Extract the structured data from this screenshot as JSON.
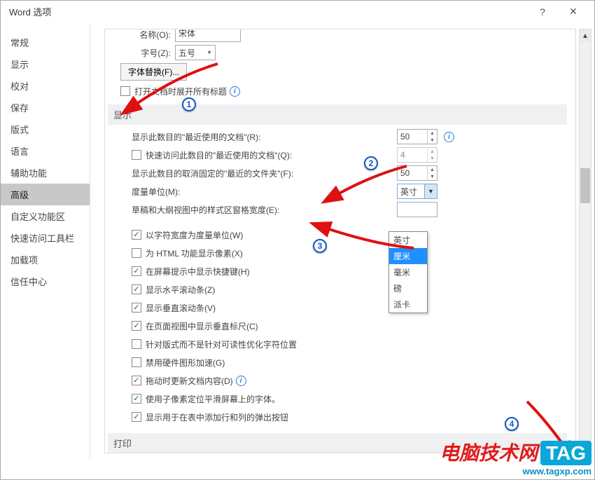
{
  "window": {
    "title": "Word 选项",
    "help": "?",
    "close": "✕"
  },
  "sidebar": {
    "items": [
      {
        "label": "常规"
      },
      {
        "label": "显示"
      },
      {
        "label": "校对"
      },
      {
        "label": "保存"
      },
      {
        "label": "版式"
      },
      {
        "label": "语言"
      },
      {
        "label": "辅助功能"
      },
      {
        "label": "高级"
      },
      {
        "label": "自定义功能区"
      },
      {
        "label": "快速访问工具栏"
      },
      {
        "label": "加载项"
      },
      {
        "label": "信任中心"
      }
    ],
    "selected_index": 7
  },
  "top": {
    "name_label": "名称(O):",
    "name_value": "宋体",
    "size_label": "字号(Z):",
    "size_value": "五号",
    "font_sub_button": "字体替换(F)...",
    "expand_titles": "打开文档时展开所有标题"
  },
  "section_display": "显示",
  "display": {
    "recent_docs_label": "显示此数目的\"最近使用的文档\"(R):",
    "recent_docs_value": "50",
    "quick_access_label": "快速访问此数目的\"最近使用的文档\"(Q):",
    "quick_access_value": "4",
    "recent_folders_label": "显示此数目的取消固定的\"最近的文件夹\"(F):",
    "recent_folders_value": "50",
    "unit_label": "度量单位(M):",
    "unit_value": "英寸",
    "unit_options": [
      "英寸",
      "厘米",
      "毫米",
      "磅",
      "派卡"
    ],
    "draft_width_label": "草稿和大纲视图中的样式区窗格宽度(E):",
    "draft_width_value": ""
  },
  "checks": [
    {
      "checked": true,
      "label": "以字符宽度为度量单位(W)"
    },
    {
      "checked": false,
      "label": "为 HTML 功能显示像素(X)"
    },
    {
      "checked": true,
      "label": "在屏幕提示中显示快捷键(H)"
    },
    {
      "checked": true,
      "label": "显示水平滚动条(Z)"
    },
    {
      "checked": true,
      "label": "显示垂直滚动条(V)"
    },
    {
      "checked": true,
      "label": "在页面视图中显示垂直标尺(C)"
    },
    {
      "checked": false,
      "label": "针对版式而不是针对可读性优化字符位置"
    },
    {
      "checked": false,
      "label": "禁用硬件图形加速(G)"
    },
    {
      "checked": true,
      "label": "拖动时更新文档内容(D)"
    },
    {
      "checked": true,
      "label": "使用子像素定位平滑屏幕上的字体。"
    },
    {
      "checked": true,
      "label": "显示用于在表中添加行和列的弹出按钮"
    }
  ],
  "section_print": "打印",
  "callouts": {
    "c1": "1",
    "c2": "2",
    "c3": "3",
    "c4": "4"
  },
  "watermark": {
    "brand_red": "电脑技术网",
    "brand_tag": "TAG",
    "url": "www.tagxp.com"
  }
}
